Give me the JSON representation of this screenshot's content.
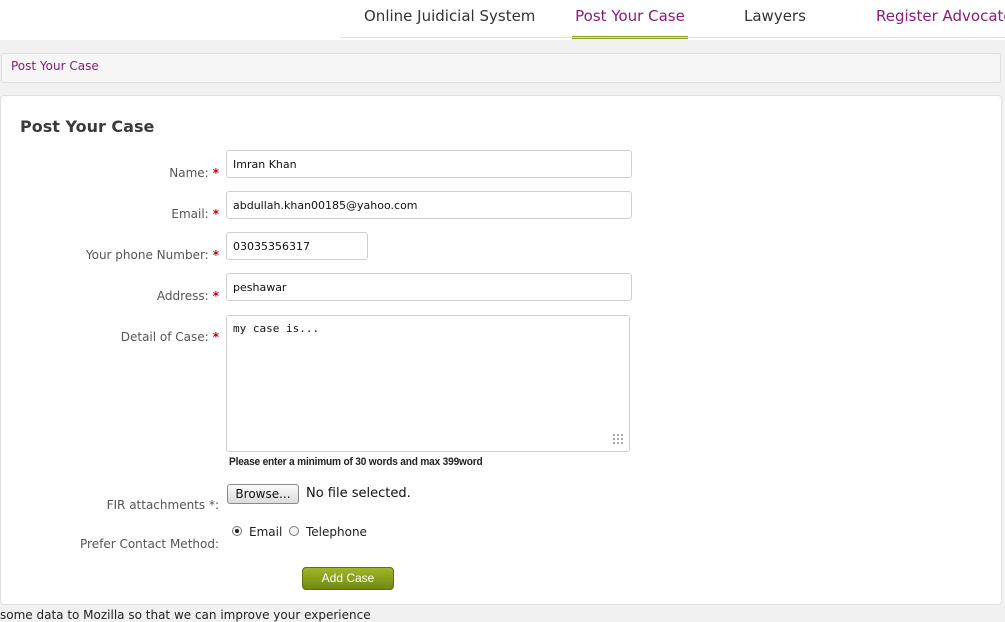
{
  "nav": {
    "items": [
      {
        "label": "Online Juidicial System"
      },
      {
        "label": "Post Your Case"
      },
      {
        "label": "Lawyers"
      },
      {
        "label": "Register Advocate"
      }
    ],
    "active_index": 1
  },
  "breadcrumb": "Post Your Case",
  "form": {
    "title": "Post Your Case",
    "required_marker": "*",
    "name": {
      "label": "Name:",
      "value": "Imran Khan"
    },
    "email": {
      "label": "Email:",
      "value": "abdullah.khan00185@yahoo.com"
    },
    "phone": {
      "label": "Your phone Number:",
      "value": "03035356317"
    },
    "address": {
      "label": "Address:",
      "value": "peshawar"
    },
    "detail": {
      "label": "Detail of Case:",
      "value": "my case is...",
      "hint": "Please enter a minimum of 30 words and max 399word"
    },
    "fir": {
      "label": "FIR attachments *:",
      "button": "Browse...",
      "status": "No file selected."
    },
    "contact": {
      "label": "Prefer Contact Method:",
      "options": [
        {
          "label": "Email",
          "selected": true
        },
        {
          "label": "Telephone",
          "selected": false
        }
      ]
    },
    "submit": "Add Case"
  },
  "notification": "some data to Mozilla so that we can improve your experience",
  "colors": {
    "accent_purple": "#8b1a7a",
    "accent_green": "#8a9a1e",
    "required_red": "#c0001a"
  }
}
